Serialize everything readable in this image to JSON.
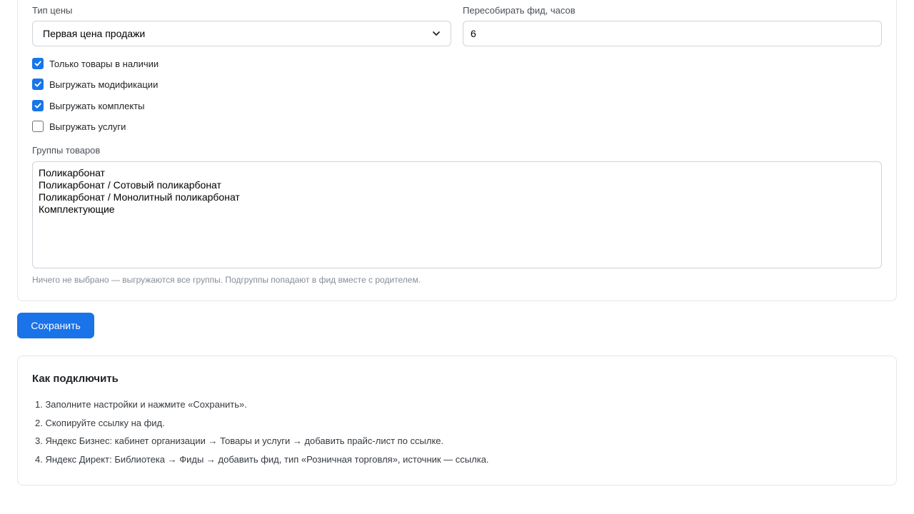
{
  "settings": {
    "price_type": {
      "label": "Тип цены",
      "selected": "Первая цена продажи"
    },
    "rebuild_hours": {
      "label": "Пересобирать фид, часов",
      "value": "6"
    },
    "checkboxes": [
      {
        "label": "Только товары в наличии",
        "checked": true
      },
      {
        "label": "Выгружать модификации",
        "checked": true
      },
      {
        "label": "Выгружать комплекты",
        "checked": true
      },
      {
        "label": "Выгружать услуги",
        "checked": false
      }
    ],
    "groups": {
      "label": "Группы товаров",
      "options": [
        "Поликарбонат",
        "Поликарбонат / Сотовый поликарбонат",
        "Поликарбонат / Монолитный поликарбонат",
        "Комплектующие"
      ],
      "hint": "Ничего не выбрано — выгружаются все группы. Подгруппы попадают в фид вместе с родителем."
    }
  },
  "actions": {
    "save_label": "Сохранить"
  },
  "help": {
    "title": "Как подключить",
    "steps": [
      "1. Заполните настройки и нажмите «Сохранить».",
      "2. Скопируйте ссылку на фид.",
      "3. Яндекс Бизнес: кабинет организации → Товары и услуги → добавить прайс-лист по ссылке.",
      "4. Яндекс Директ: Библиотека → Фиды → добавить фид, тип «Розничная торговля», источник — ссылка."
    ]
  },
  "colors": {
    "accent": "#1a73e8",
    "border": "#ced4da",
    "hint": "#868e96"
  }
}
